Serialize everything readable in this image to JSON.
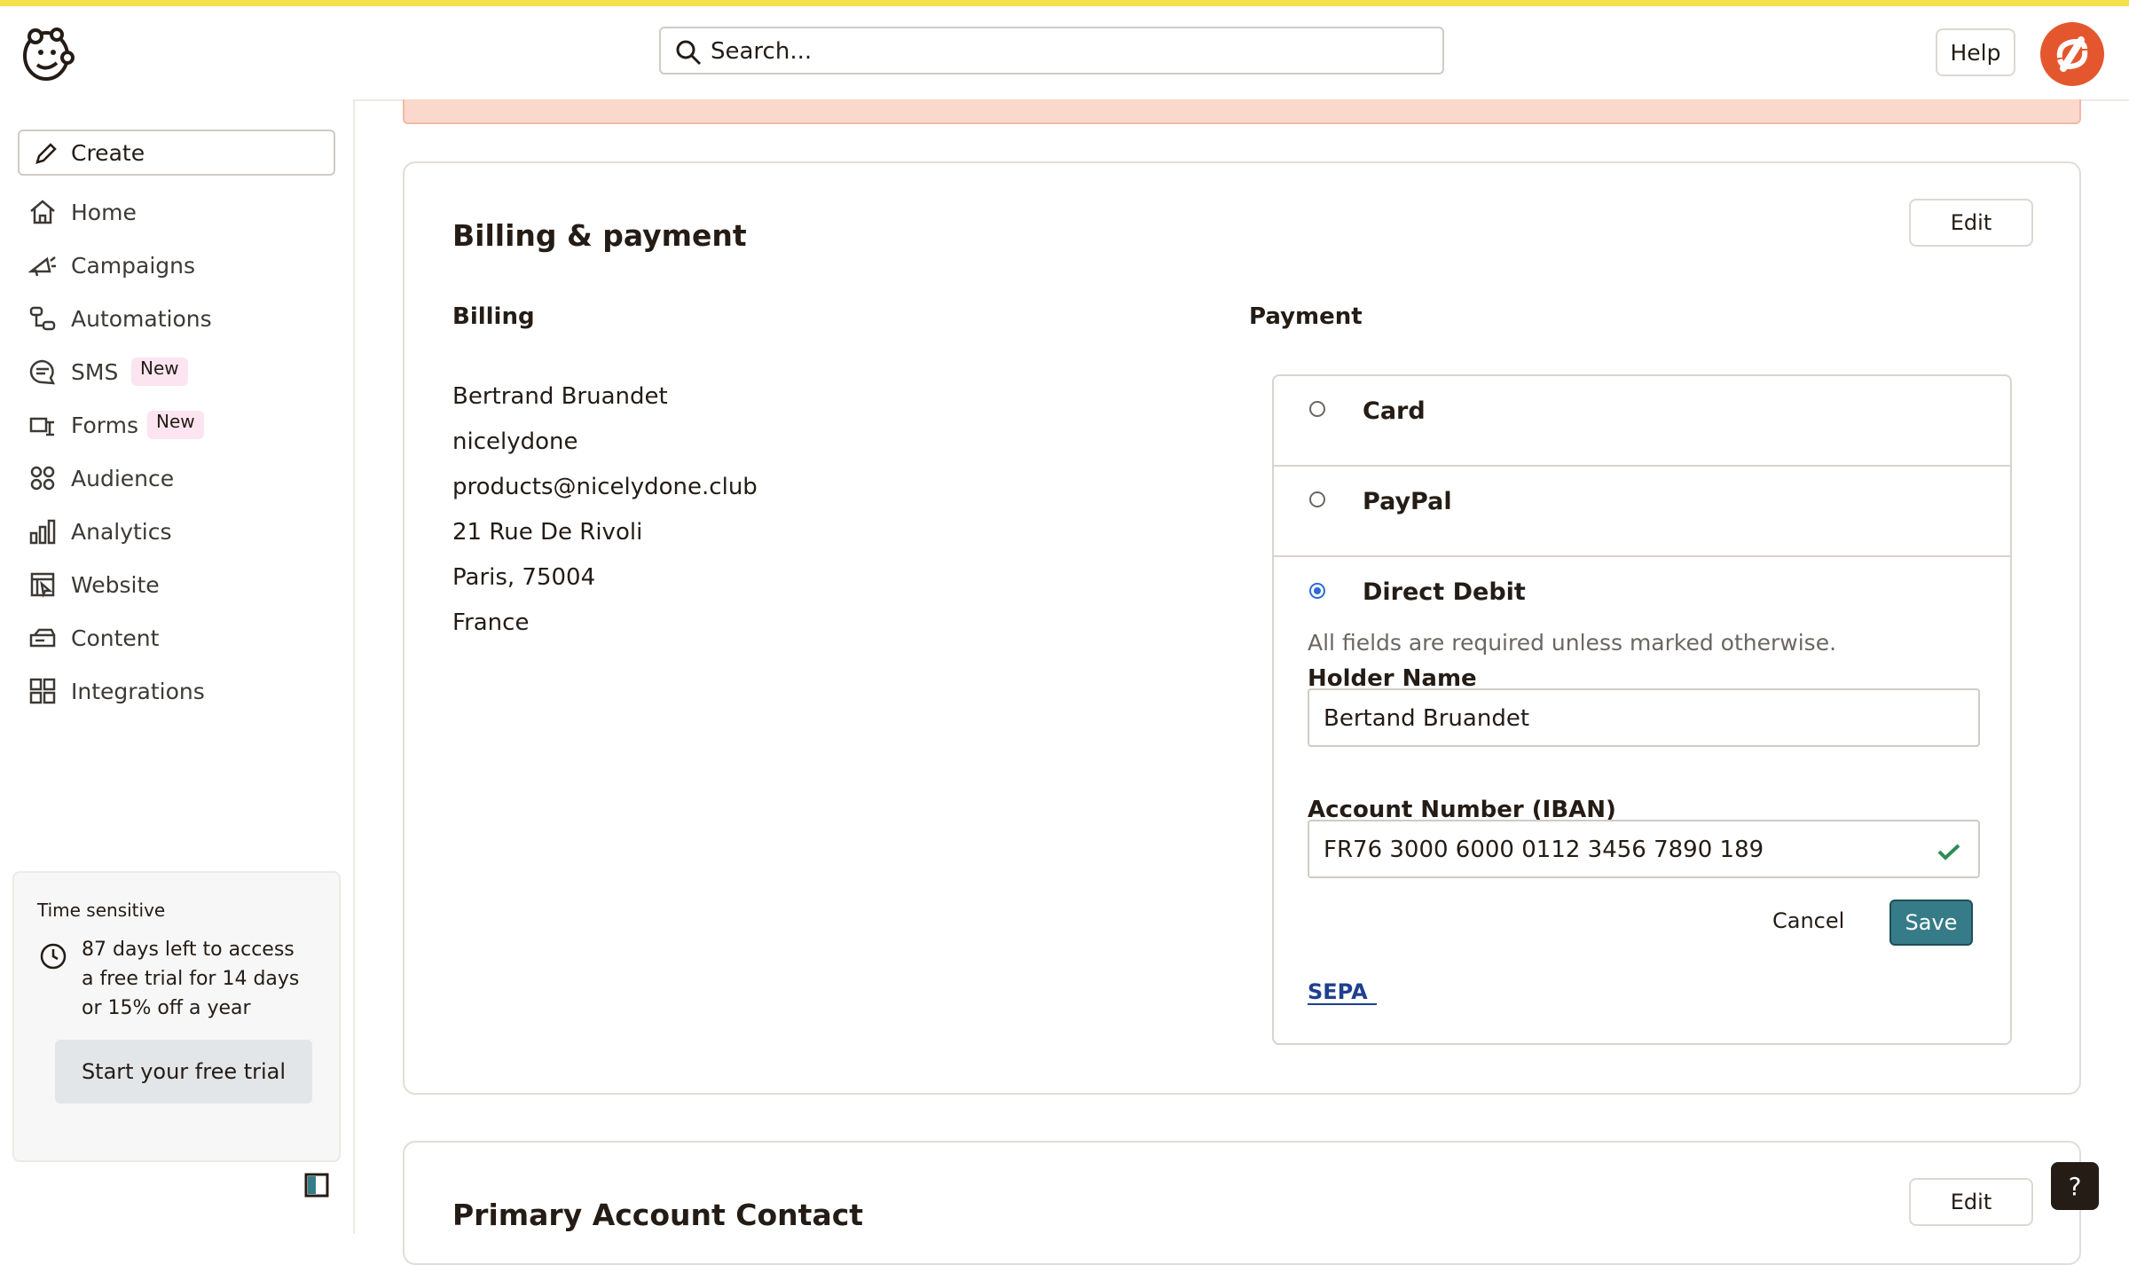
{
  "header": {
    "search_placeholder": "Search...",
    "help_label": "Help"
  },
  "sidebar": {
    "create_label": "Create",
    "items": [
      {
        "label": "Home",
        "icon": "home-icon"
      },
      {
        "label": "Campaigns",
        "icon": "megaphone-icon"
      },
      {
        "label": "Automations",
        "icon": "automations-icon"
      },
      {
        "label": "SMS",
        "icon": "sms-icon",
        "badge": "New"
      },
      {
        "label": "Forms",
        "icon": "forms-icon",
        "badge": "New"
      },
      {
        "label": "Audience",
        "icon": "audience-icon"
      },
      {
        "label": "Analytics",
        "icon": "analytics-icon"
      },
      {
        "label": "Website",
        "icon": "website-icon"
      },
      {
        "label": "Content",
        "icon": "content-icon"
      },
      {
        "label": "Integrations",
        "icon": "integrations-icon"
      }
    ],
    "trial": {
      "tag": "Time sensitive",
      "message": "87 days left to access a free trial for 14 days or 15% off a year",
      "button": "Start your free trial"
    }
  },
  "billing_card": {
    "title": "Billing & payment",
    "edit_label": "Edit",
    "billing_heading": "Billing",
    "billing_lines": [
      "Bertrand Bruandet",
      "nicelydone",
      "products@nicelydone.club",
      "21 Rue De Rivoli",
      "Paris, 75004",
      "France"
    ],
    "payment_heading": "Payment",
    "options": [
      {
        "label": "Card",
        "selected": false
      },
      {
        "label": "PayPal",
        "selected": false
      },
      {
        "label": "Direct Debit",
        "selected": true
      }
    ],
    "hint": "All fields are required unless marked otherwise.",
    "holder_label": "Holder Name",
    "holder_value": "Bertand Bruandet",
    "iban_label": "Account Number (IBAN)",
    "iban_value": "FR76 3000 6000 0112 3456 7890 189",
    "cancel_label": "Cancel",
    "save_label": "Save",
    "logo_text": "SEPA",
    "colors": {
      "save": "#367c88",
      "radio": "#2c6ad8",
      "check": "#2e8b57"
    }
  },
  "contact_card": {
    "title": "Primary Account Contact",
    "edit_label": "Edit"
  },
  "help_fab": "?"
}
